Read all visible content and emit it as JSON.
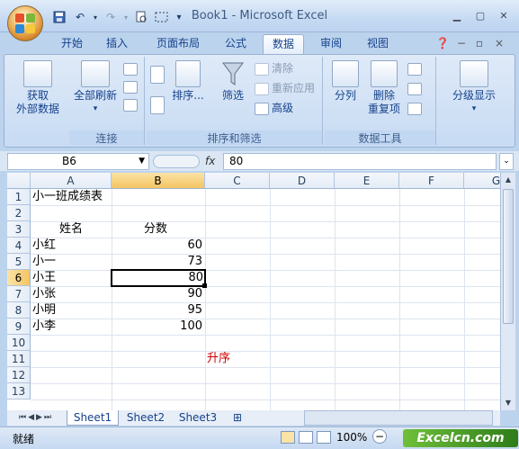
{
  "window": {
    "title": "Book1 - Microsoft Excel"
  },
  "tabs": [
    "开始",
    "插入",
    "页面布局",
    "公式",
    "数据",
    "审阅",
    "视图"
  ],
  "ribbon": {
    "get_external_label": "获取\n外部数据",
    "refresh_label": "全部刷新",
    "group_connections": "连接",
    "sort_label": "排序...",
    "filter_label": "筛选",
    "clear_label": "清除",
    "reapply_label": "重新应用",
    "advanced_label": "高级",
    "group_sort_filter": "排序和筛选",
    "text_to_cols_label": "分列",
    "remove_dup_label": "删除\n重复项",
    "group_data_tools": "数据工具",
    "outline_label": "分级显示"
  },
  "formula_bar": {
    "name_box": "B6",
    "fx": "fx",
    "value": "80"
  },
  "columns": [
    "A",
    "B",
    "C",
    "D",
    "E",
    "F",
    "G"
  ],
  "rows": [
    "1",
    "2",
    "3",
    "4",
    "5",
    "6",
    "7",
    "8",
    "9",
    "10",
    "11",
    "12",
    "13"
  ],
  "cells": {
    "a1": "小一班成绩表",
    "a3": "姓名",
    "b3": "分数",
    "a4": "小红",
    "b4": "60",
    "a5": "小一",
    "b5": "73",
    "a6": "小王",
    "b6": "80",
    "a7": "小张",
    "b7": "90",
    "a8": "小明",
    "b8": "95",
    "a9": "小李",
    "b9": "100",
    "c11": "升序"
  },
  "sheets": [
    "Sheet1",
    "Sheet2",
    "Sheet3"
  ],
  "status": {
    "ready": "就绪",
    "zoom": "100%",
    "watermark": "Excelcn.com"
  },
  "colors": {
    "accent_red": "#cc0000",
    "selected_header": "#f4c462"
  }
}
